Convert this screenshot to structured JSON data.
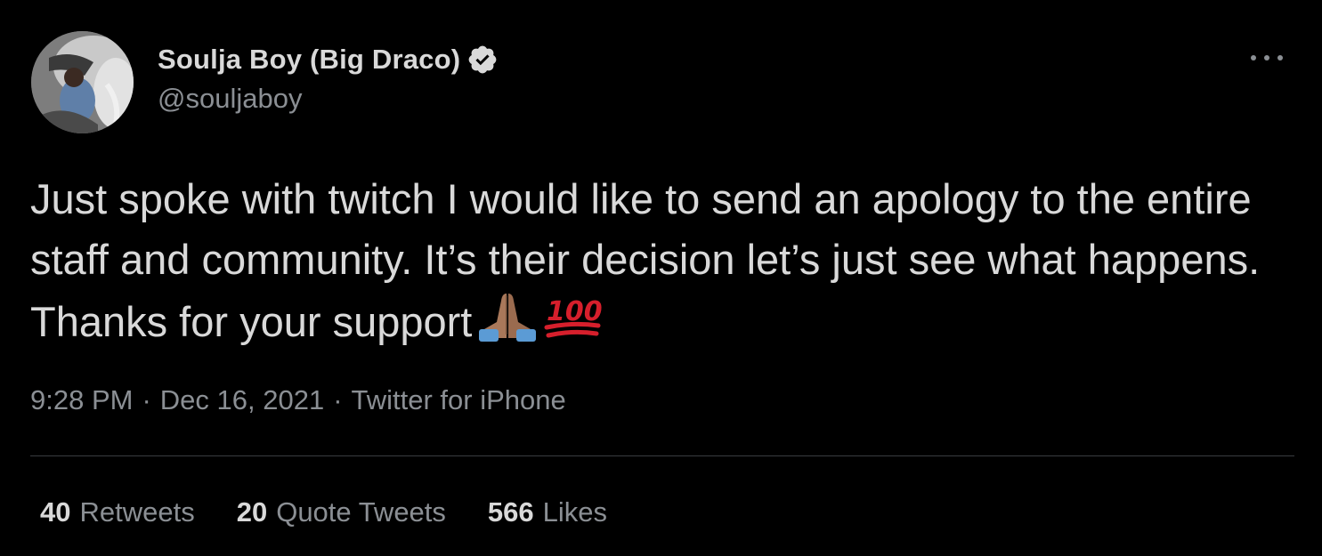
{
  "author": {
    "display_name": "Soulja Boy (Big Draco)",
    "handle": "@souljaboy",
    "verified": true
  },
  "tweet": {
    "text": "Just spoke with twitch I would like to send an apology to the entire staff and community. It’s their decision let’s just see what happens. Thanks for your support",
    "emojis": [
      "folded-hands-emoji",
      "hundred-points-emoji"
    ]
  },
  "meta": {
    "time": "9:28 PM",
    "date": "Dec 16, 2021",
    "source": "Twitter for iPhone",
    "separator": "·"
  },
  "stats": {
    "retweets": {
      "count": "40",
      "label": "Retweets"
    },
    "quote_tweets": {
      "count": "20",
      "label": "Quote Tweets"
    },
    "likes": {
      "count": "566",
      "label": "Likes"
    }
  },
  "icons": {
    "more": "more-options-icon",
    "verified": "verified-badge-icon"
  },
  "colors": {
    "background": "#000000",
    "primary_text": "#d9d9d9",
    "secondary_text": "#8b8f94",
    "divider": "#3a3d40",
    "hundred_red": "#d61f2c",
    "hands_skin": "#a9785a",
    "sleeve_blue": "#5b9bd5"
  }
}
